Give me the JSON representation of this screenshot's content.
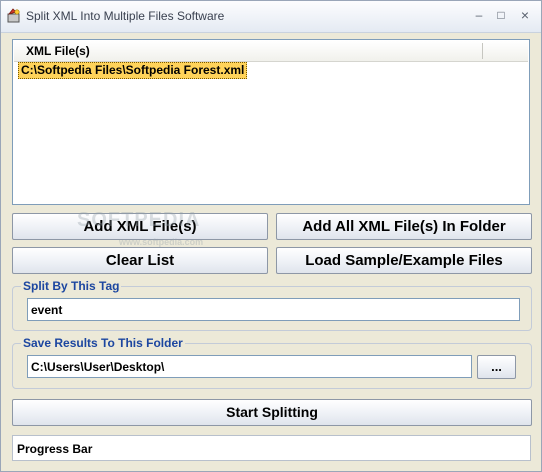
{
  "window": {
    "title": "Split XML Into Multiple Files Software"
  },
  "controls": {
    "minimize": "–",
    "maximize": "□",
    "close": "×"
  },
  "file_list": {
    "column_header": "XML File(s)",
    "items": [
      "C:\\Softpedia Files\\Softpedia Forest.xml"
    ]
  },
  "buttons": {
    "add_files": "Add XML File(s)",
    "add_folder": "Add All XML File(s) In Folder",
    "clear_list": "Clear List",
    "load_sample": "Load Sample/Example Files",
    "browse": "...",
    "start": "Start Splitting"
  },
  "split_tag": {
    "label": "Split By This Tag",
    "value": "event"
  },
  "output": {
    "label": "Save Results To This Folder",
    "value": "C:\\Users\\User\\Desktop\\"
  },
  "progress": {
    "text": "Progress Bar"
  },
  "watermark": {
    "brand": "SOFTPEDIA",
    "url": "www.softpedia.com"
  }
}
